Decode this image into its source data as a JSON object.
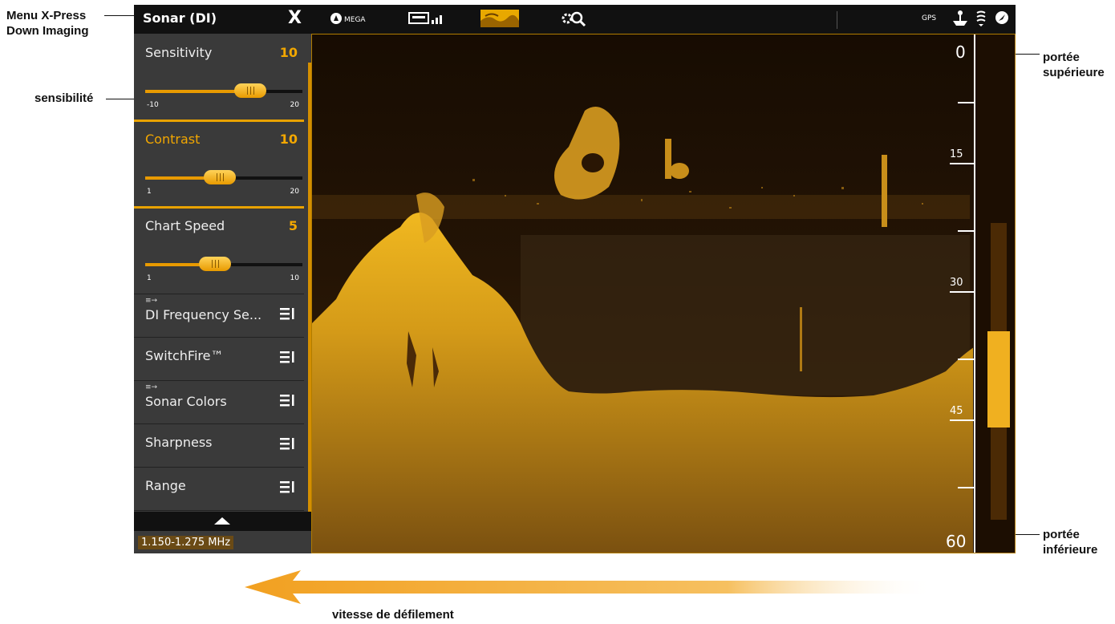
{
  "callouts": {
    "menu": [
      "Menu X-Press",
      "Down Imaging"
    ],
    "sensitivity": "sensibilité",
    "upper_range": [
      "portée",
      "supérieure"
    ],
    "lower_range": [
      "portée",
      "inférieure"
    ],
    "chart_speed": "vitesse de défilement"
  },
  "topbar": {
    "title": "Sonar (DI)",
    "close_glyph": "X",
    "mega_label": "MEGA",
    "gps_label": "GPS"
  },
  "menu": {
    "sliders": [
      {
        "label": "Sensitivity",
        "value": "10",
        "min": "-10",
        "max": "20",
        "fraction": 0.6667
      },
      {
        "label": "Contrast",
        "value": "10",
        "min": "1",
        "max": "20",
        "fraction": 0.4737
      },
      {
        "label": "Chart Speed",
        "value": "5",
        "min": "1",
        "max": "10",
        "fraction": 0.4444
      }
    ],
    "items": [
      {
        "label": "DI Frequency Se...",
        "sub": "≡→"
      },
      {
        "label": "SwitchFire™",
        "sub": ""
      },
      {
        "label": "Sonar Colors",
        "sub": "≡→"
      },
      {
        "label": "Sharpness",
        "sub": ""
      },
      {
        "label": "Range",
        "sub": ""
      }
    ],
    "frequency": "1.150-1.275 MHz"
  },
  "depth_scale": {
    "labels": [
      "0",
      "15",
      "30",
      "45",
      "60"
    ]
  },
  "colors": {
    "accent": "#f2a700",
    "background": "#1a1005",
    "menu_bg": "#3a3a3a"
  },
  "icons": [
    "mega-icon",
    "chart-split-icon",
    "sonar-view-icon",
    "settings-search-icon",
    "gps-icon",
    "boat-icon",
    "sonar-status-icon",
    "compass-icon",
    "menu-list-icon",
    "chevron-up-icon"
  ]
}
